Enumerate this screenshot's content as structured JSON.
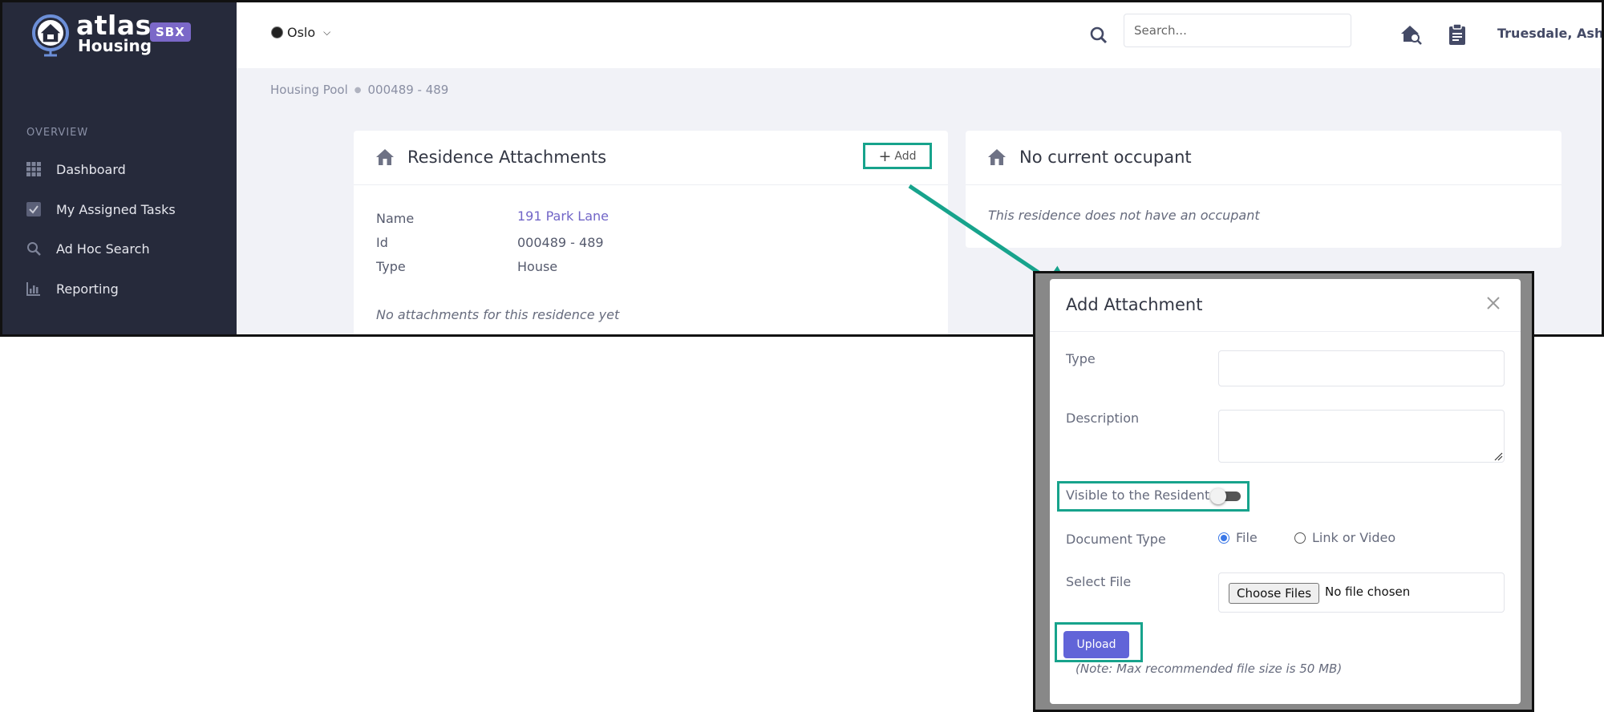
{
  "brand": {
    "name": "atlas",
    "product": "Housing",
    "env_badge": "SBX"
  },
  "topbar": {
    "location": "Oslo",
    "search_placeholder": "Search...",
    "user_name": "Truesdale, Ashley"
  },
  "sidebar": {
    "section": "OVERVIEW",
    "items": [
      {
        "label": "Dashboard",
        "icon": "grid-icon"
      },
      {
        "label": "My Assigned Tasks",
        "icon": "check-square-icon"
      },
      {
        "label": "Ad Hoc Search",
        "icon": "search-icon"
      },
      {
        "label": "Reporting",
        "icon": "bar-chart-icon"
      }
    ]
  },
  "breadcrumb": {
    "parent": "Housing Pool",
    "current": "000489 - 489"
  },
  "attachments_card": {
    "title": "Residence Attachments",
    "add_label": "Add",
    "fields": [
      {
        "label": "Name",
        "value": "191 Park Lane"
      },
      {
        "label": "Id",
        "value": "000489 - 489"
      },
      {
        "label": "Type",
        "value": "House"
      }
    ],
    "empty_text": "No attachments for this residence yet"
  },
  "occupant_card": {
    "title": "No current occupant",
    "note": "This residence does not have an occupant"
  },
  "modal": {
    "title": "Add Attachment",
    "type_label": "Type",
    "description_label": "Description",
    "visible_label": "Visible to the Resident",
    "visible_on": false,
    "doc_type_label": "Document Type",
    "doc_type_options": [
      "File",
      "Link or Video"
    ],
    "doc_type_selected": "File",
    "select_file_label": "Select File",
    "choose_files_label": "Choose Files",
    "no_file_text": "No file chosen",
    "upload_label": "Upload",
    "note": "(Note: Max recommended file size is 50 MB)"
  },
  "colors": {
    "sidebar_bg": "#262a3b",
    "highlight": "#17a38c",
    "primary": "#6164d8",
    "link": "#7165c7"
  }
}
